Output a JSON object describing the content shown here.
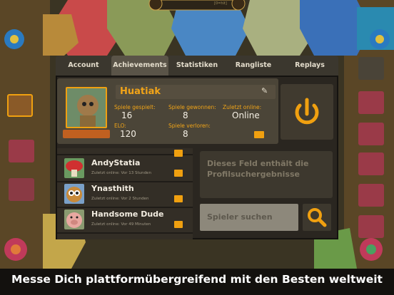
{
  "tabs": [
    {
      "label": "Account"
    },
    {
      "label": "Achievements"
    },
    {
      "label": "Statistiken"
    },
    {
      "label": "Rangliste"
    },
    {
      "label": "Replays"
    }
  ],
  "profile": {
    "name": "Huatiak",
    "stats": {
      "games_played_label": "Spiele gespielt:",
      "games_played": "16",
      "games_won_label": "Spiele gewonnen:",
      "games_won": "8",
      "last_online_label": "Zuletzt online:",
      "last_online": "Online",
      "elo_label": "ELO:",
      "elo": "120",
      "games_lost_label": "Spiele verloren:",
      "games_lost": "8"
    }
  },
  "players": [
    {
      "name": "AndyStatia",
      "last_online": "Zuletzt online:    Vor 13 Stunden"
    },
    {
      "name": "Ynasthith",
      "last_online": "Zuletzt online:    Vor 2 Stunden"
    },
    {
      "name": "Handsome Dude",
      "last_online": "Zuletzt online:    Vor 49 Minuten"
    }
  ],
  "results_placeholder": "Dieses Feld enthält die Profilsuchergebnisse",
  "search": {
    "placeholder": "Spieler suchen"
  },
  "top_status": "[0=hit]",
  "caption": "Messe Dich plattformübergreifend mit den Besten weltweit",
  "colors": {
    "accent": "#f0a010",
    "panel": "#2a2620",
    "text": "#f4efe4"
  }
}
